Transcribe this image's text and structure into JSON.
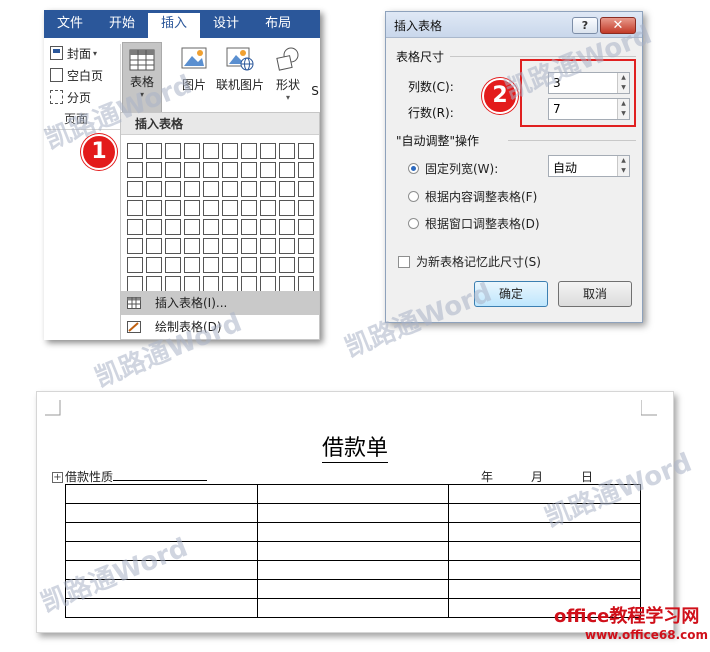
{
  "ribbon": {
    "tabs": [
      "文件",
      "开始",
      "插入",
      "设计",
      "布局"
    ],
    "active_tab": "插入",
    "pages_group": {
      "items": [
        {
          "label": "封面",
          "icon": "cover-icon",
          "dropdown": true
        },
        {
          "label": "空白页",
          "icon": "blank-page-icon"
        },
        {
          "label": "分页",
          "icon": "page-break-icon"
        }
      ],
      "label": "页面"
    },
    "table_button": {
      "label": "表格",
      "icon": "table-icon"
    },
    "insert_buttons": [
      {
        "label": "图片",
        "icon": "picture-icon"
      },
      {
        "label": "联机图片",
        "icon": "online-picture-icon"
      },
      {
        "label": "形状",
        "icon": "shapes-icon"
      },
      {
        "label": "S",
        "icon": ""
      }
    ],
    "dropdown": {
      "header": "插入表格",
      "grid_cols": 10,
      "grid_rows": 8,
      "items": [
        {
          "label": "插入表格(I)...",
          "icon": "insert-table-icon"
        },
        {
          "label": "绘制表格(D)",
          "icon": "draw-table-icon"
        }
      ]
    }
  },
  "dialog": {
    "title": "插入表格",
    "help": "?",
    "section_size": "表格尺寸",
    "columns_label": "列数(C):",
    "columns_value": "3",
    "rows_label": "行数(R):",
    "rows_value": "7",
    "section_autofit": "\"自动调整\"操作",
    "radios": [
      {
        "label": "固定列宽(W):",
        "selected": true
      },
      {
        "label": "根据内容调整表格(F)",
        "selected": false
      },
      {
        "label": "根据窗口调整表格(D)",
        "selected": false
      }
    ],
    "fixed_width_value": "自动",
    "remember_label": "为新表格记忆此尺寸(S)",
    "ok": "确定",
    "cancel": "取消"
  },
  "badges": [
    "1",
    "2"
  ],
  "document": {
    "title": "借款单",
    "loan_type_label": "借款性质",
    "year": "年",
    "month": "月",
    "day": "日",
    "table_rows": 7,
    "table_cols": 3
  },
  "watermark": "凯路通Word",
  "footer": {
    "site": "office教程学习网",
    "url": "www.office68.com"
  },
  "colors": {
    "ribbon": "#2b579a",
    "badge": "#e31b1b",
    "highlight_box": "#e02020",
    "footer": "#d0101a"
  }
}
